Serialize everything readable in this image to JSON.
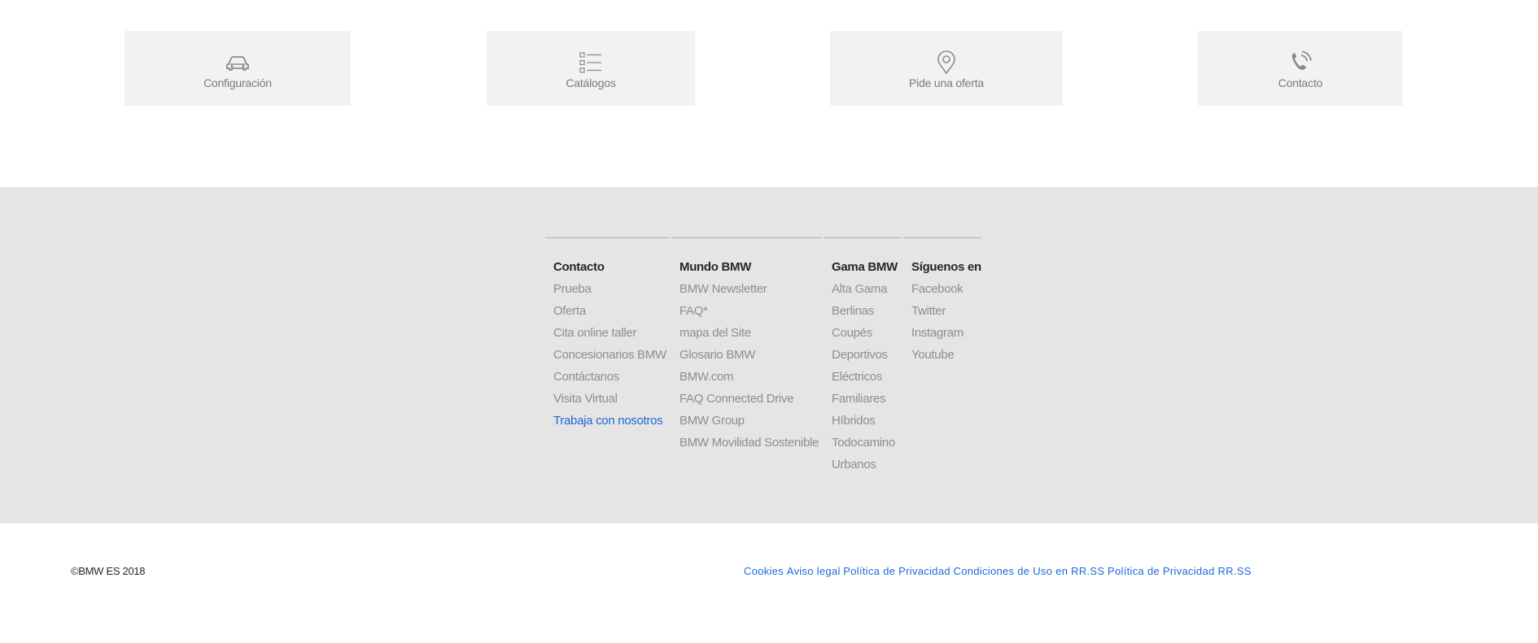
{
  "quick_links": [
    {
      "label": "Configuración",
      "icon": "car-icon"
    },
    {
      "label": "Catálogos",
      "icon": "list-icon"
    },
    {
      "label": "Pide una oferta",
      "icon": "location-pin-icon"
    },
    {
      "label": "Contacto",
      "icon": "phone-icon"
    }
  ],
  "footer": {
    "columns": [
      {
        "title": "Contacto",
        "links": [
          "Prueba",
          "Oferta",
          "Cita online taller",
          "Concesionarios BMW",
          "Contáctanos",
          "Visita Virtual",
          "Trabaja con nosotros"
        ]
      },
      {
        "title": "Mundo BMW",
        "links": [
          "BMW Newsletter",
          "FAQ*",
          "mapa del Site",
          "Glosario BMW",
          "BMW.com",
          "FAQ Connected Drive",
          "BMW Group",
          "BMW Movilidad Sostenible"
        ]
      },
      {
        "title": "Gama BMW",
        "links": [
          "Alta Gama",
          "Berlinas",
          "Coupés",
          "Deportivos",
          "Eléctricos",
          "Familiares",
          "Híbridos",
          "Todocamino",
          "Urbanos"
        ]
      },
      {
        "title": "Síguenos en",
        "links": [
          "Facebook",
          "Twitter",
          "Instagram",
          "Youtube"
        ]
      }
    ]
  },
  "bottom": {
    "copyright": "©BMW ES 2018",
    "legal_links": [
      "Cookies",
      "Aviso legal",
      "Política de Privacidad",
      "Condiciones de Uso en RR.SS",
      "Política de Privacidad RR.SS"
    ]
  },
  "colors": {
    "tile_bg": "#f2f2f2",
    "footer_bg": "#e5e5e5",
    "link_gray": "#8e8e8e",
    "accent_blue": "#1c69d4"
  }
}
